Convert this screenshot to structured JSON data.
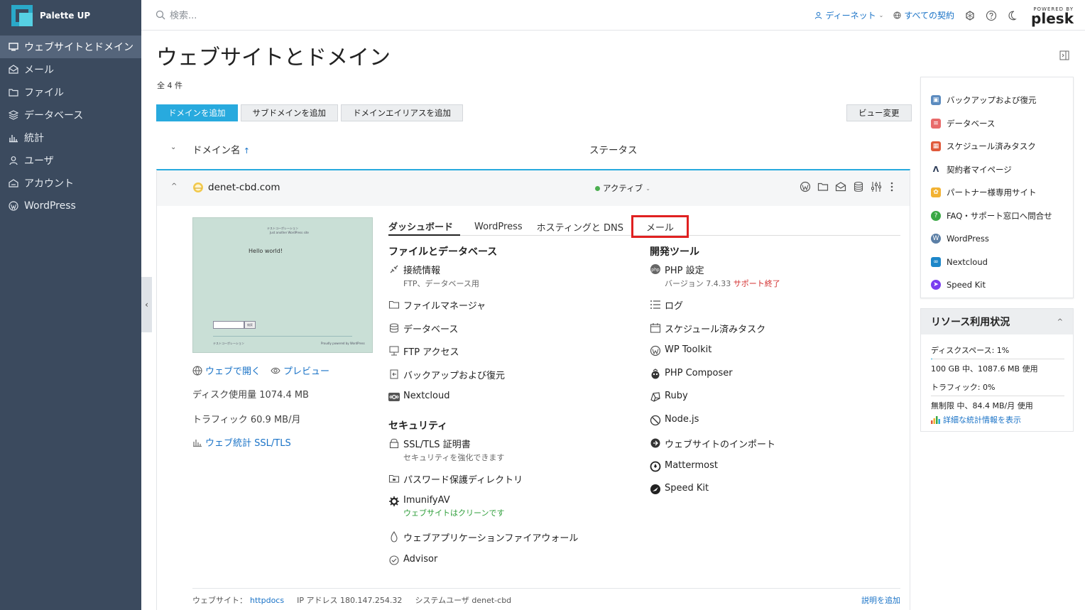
{
  "app": {
    "name": "Palette UP"
  },
  "sidebar": {
    "items": [
      {
        "label": "ウェブサイトとドメイン",
        "icon": "monitor-icon",
        "active": true
      },
      {
        "label": "メール",
        "icon": "mail-icon",
        "active": false
      },
      {
        "label": "ファイル",
        "icon": "folder-icon",
        "active": false
      },
      {
        "label": "データベース",
        "icon": "layers-icon",
        "active": false
      },
      {
        "label": "統計",
        "icon": "bar-chart-icon",
        "active": false
      },
      {
        "label": "ユーザ",
        "icon": "user-icon",
        "active": false
      },
      {
        "label": "アカウント",
        "icon": "account-icon",
        "active": false
      },
      {
        "label": "WordPress",
        "icon": "wordpress-icon",
        "active": false
      }
    ]
  },
  "header": {
    "search_placeholder": "検索...",
    "user_label": "ディーネット",
    "subscriptions_label": "すべての契約",
    "brand_powered": "POWERED BY",
    "brand_name": "plesk"
  },
  "page": {
    "title": "ウェブサイトとドメイン",
    "count": "全 4 件"
  },
  "toolbar": {
    "add_domain": "ドメインを追加",
    "add_subdomain": "サブドメインを追加",
    "add_alias": "ドメインエイリアスを追加",
    "change_view": "ビュー変更"
  },
  "list": {
    "col_domain": "ドメイン名",
    "sort_arrow": "↑",
    "col_status": "ステータス"
  },
  "domain": {
    "name": "denet-cbd.com",
    "status": "アクティブ",
    "thumbnail": {
      "site_title": "テストコーポレーション",
      "site_tagline": "Just another WordPress site",
      "hello": "Hello world!",
      "footer_left": "テストコーポレーション",
      "footer_right": "Proudly powered by WordPress",
      "search_button": "検索"
    },
    "open_web": "ウェブで開く",
    "preview": "プレビュー",
    "disk_usage": "ディスク使用量 1074.4 MB",
    "traffic": "トラフィック 60.9 MB/月",
    "web_stats": "ウェブ統計 SSL/TLS",
    "tabs": [
      "ダッシュボード",
      "WordPress",
      "ホスティングと DNS",
      "メール"
    ],
    "files_db": {
      "title": "ファイルとデータベース",
      "items": [
        {
          "label": "接続情報",
          "sub": "FTP、データベース用",
          "icon": "connection-icon"
        },
        {
          "label": "ファイルマネージャ",
          "icon": "folder-icon"
        },
        {
          "label": "データベース",
          "icon": "database-icon"
        },
        {
          "label": "FTP アクセス",
          "icon": "ftp-icon"
        },
        {
          "label": "バックアップおよび復元",
          "icon": "backup-icon"
        },
        {
          "label": "Nextcloud",
          "icon": "nextcloud-icon"
        }
      ]
    },
    "security": {
      "title": "セキュリティ",
      "items": [
        {
          "label": "SSL/TLS 証明書",
          "sub": "セキュリティを強化できます",
          "icon": "ssl-icon"
        },
        {
          "label": "パスワード保護ディレクトリ",
          "icon": "password-folder-icon"
        },
        {
          "label": "ImunifyAV",
          "sub": "ウェブサイトはクリーンです",
          "icon": "imunify-icon"
        },
        {
          "label": "ウェブアプリケーションファイアウォール",
          "icon": "firewall-icon"
        },
        {
          "label": "Advisor",
          "icon": "advisor-icon"
        }
      ]
    },
    "dev_tools": {
      "title": "開発ツール",
      "php_label": "PHP 設定",
      "php_sub": "バージョン 7.4.33 ",
      "php_sub_warn": "サポート終了",
      "items": [
        {
          "label": "ログ",
          "icon": "log-icon"
        },
        {
          "label": "スケジュール済みタスク",
          "icon": "calendar-icon"
        },
        {
          "label": "WP Toolkit",
          "icon": "wordpress-icon"
        },
        {
          "label": "PHP Composer",
          "icon": "composer-icon"
        },
        {
          "label": "Ruby",
          "icon": "ruby-icon"
        },
        {
          "label": "Node.js",
          "icon": "nodejs-icon"
        },
        {
          "label": "ウェブサイトのインポート",
          "icon": "import-icon"
        },
        {
          "label": "Mattermost",
          "icon": "mattermost-icon"
        },
        {
          "label": "Speed Kit",
          "icon": "speedkit-icon"
        }
      ]
    },
    "footer": {
      "website_label": "ウェブサイト：",
      "website_value": "httpdocs",
      "ip": "IP アドレス 180.147.254.32",
      "sysuser": "システムユーザ denet-cbd",
      "add_note": "説明を追加"
    }
  },
  "right_panel": {
    "items": [
      {
        "label": "バックアップおよび復元",
        "icon": "backup-icon",
        "color": "#5b8bbf"
      },
      {
        "label": "データベース",
        "icon": "database-icon",
        "color": "#e86a6a"
      },
      {
        "label": "スケジュール済みタスク",
        "icon": "calendar-icon",
        "color": "#e0593a"
      },
      {
        "label": "契約者マイページ",
        "icon": "a-logo-icon",
        "color": "#2b3a55"
      },
      {
        "label": "パートナー様専用サイト",
        "icon": "partner-icon",
        "color": "#f2b233"
      },
      {
        "label": "FAQ・サポート窓口へ問合せ",
        "icon": "support-icon",
        "color": "#3aa845"
      },
      {
        "label": "WordPress",
        "icon": "wordpress-icon",
        "color": "#5b7fa6"
      },
      {
        "label": "Nextcloud",
        "icon": "nextcloud-icon",
        "color": "#1d87c9"
      },
      {
        "label": "Speed Kit",
        "icon": "speedkit-icon",
        "color": "#7a3cf0"
      }
    ]
  },
  "resources": {
    "title": "リソース利用状況",
    "disk_label": "ディスクスペース: 1%",
    "disk_detail": "100 GB 中、1087.6 MB 使用",
    "traffic_label": "トラフィック: 0%",
    "traffic_detail": "無制限 中、84.4 MB/月 使用",
    "details_link": "詳細な統計情報を表示"
  }
}
